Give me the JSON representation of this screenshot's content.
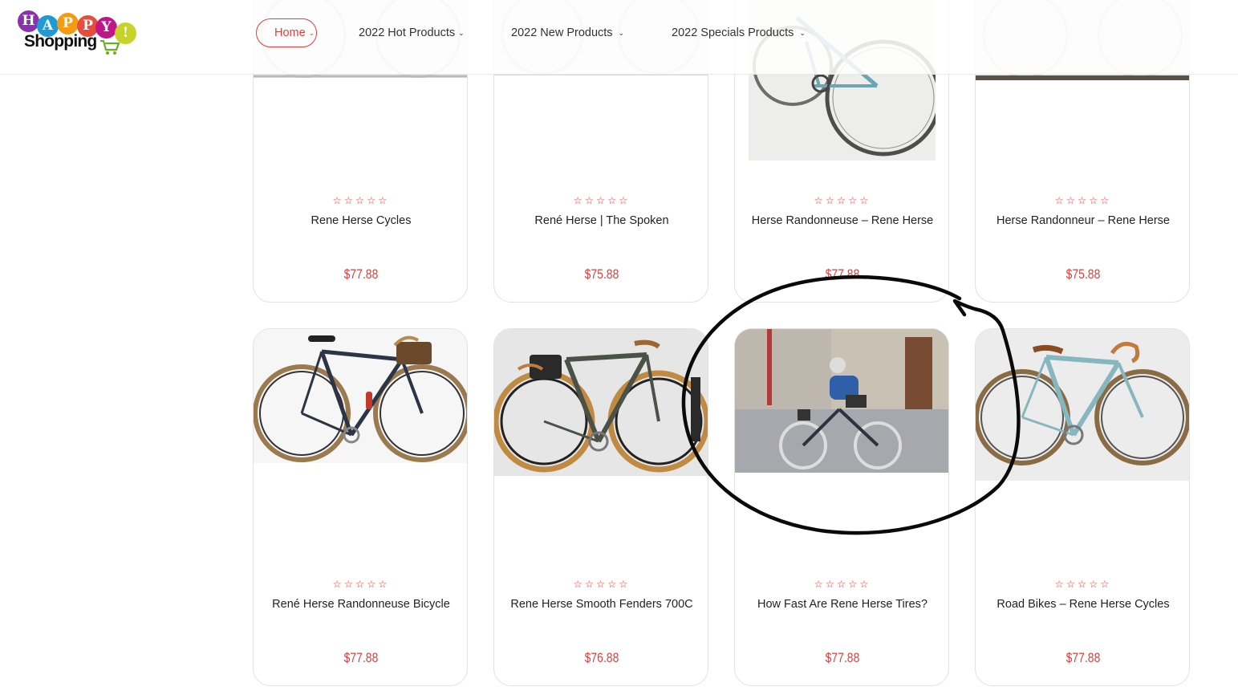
{
  "brand": {
    "logo_letters": [
      "H",
      "A",
      "P",
      "P",
      "Y",
      "!"
    ],
    "logo_word": "Shopping",
    "colors": {
      "accent": "#d9413f"
    }
  },
  "nav": {
    "items": [
      {
        "label": "Home",
        "active": true
      },
      {
        "label": "2022 Hot Products",
        "active": false
      },
      {
        "label": "2022 New Products",
        "active": false
      },
      {
        "label": "2022 Specials Products",
        "active": false
      }
    ]
  },
  "products": [
    {
      "title": "Rene Herse Cycles",
      "price": "$77.88",
      "rating": "☆☆☆☆☆"
    },
    {
      "title": "René Herse | The Spoken",
      "price": "$75.88",
      "rating": "☆☆☆☆☆"
    },
    {
      "title": "Herse Randonneuse – Rene Herse",
      "price": "$77.88",
      "rating": "☆☆☆☆☆"
    },
    {
      "title": "Herse Randonneur – Rene Herse",
      "price": "$75.88",
      "rating": "☆☆☆☆☆"
    },
    {
      "title": "René Herse Randonneuse Bicycle",
      "price": "$77.88",
      "rating": "☆☆☆☆☆"
    },
    {
      "title": "Rene Herse Smooth Fenders 700C",
      "price": "$76.88",
      "rating": "☆☆☆☆☆"
    },
    {
      "title": "How Fast Are Rene Herse Tires?",
      "price": "$77.88",
      "rating": "☆☆☆☆☆"
    },
    {
      "title": "Road Bikes – Rene Herse Cycles",
      "price": "$77.88",
      "rating": "☆☆☆☆☆"
    }
  ]
}
